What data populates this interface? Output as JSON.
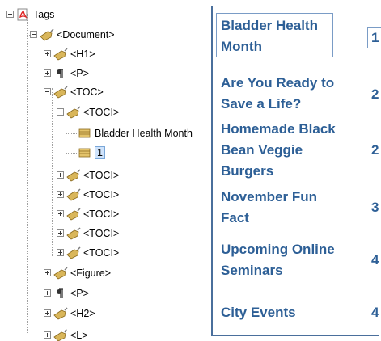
{
  "tree": {
    "root_label": "Tags",
    "nodes": [
      {
        "label": "<Document>",
        "state": "minus",
        "icon": "tag-icon"
      },
      {
        "label": "<H1>",
        "state": "plus",
        "icon": "tag-icon"
      },
      {
        "label": "<P>",
        "state": "plus",
        "icon": "paragraph-icon"
      },
      {
        "label": "<TOC>",
        "state": "minus",
        "icon": "tag-icon"
      },
      {
        "label": "<TOCI>",
        "state": "minus",
        "icon": "tag-icon"
      },
      {
        "label": "Bladder Health Month",
        "state": "leaf",
        "icon": "content-icon"
      },
      {
        "label": "1",
        "state": "leaf",
        "icon": "content-icon",
        "selected": true
      },
      {
        "label": "<TOCI>",
        "state": "plus",
        "icon": "tag-icon"
      },
      {
        "label": "<TOCI>",
        "state": "plus",
        "icon": "tag-icon"
      },
      {
        "label": "<TOCI>",
        "state": "plus",
        "icon": "tag-icon"
      },
      {
        "label": "<TOCI>",
        "state": "plus",
        "icon": "tag-icon"
      },
      {
        "label": "<TOCI>",
        "state": "plus",
        "icon": "tag-icon"
      },
      {
        "label": "<Figure>",
        "state": "plus",
        "icon": "tag-icon"
      },
      {
        "label": "<P>",
        "state": "plus",
        "icon": "paragraph-icon"
      },
      {
        "label": "<H2>",
        "state": "plus",
        "icon": "tag-icon"
      },
      {
        "label": "<L>",
        "state": "plus",
        "icon": "tag-icon"
      }
    ]
  },
  "toc": {
    "entries": [
      {
        "title": "Bladder Health Month",
        "page": "1"
      },
      {
        "title": "Are You Ready to Save a Life?",
        "page": "2"
      },
      {
        "title": "Homemade Black Bean Veggie Burgers",
        "page": "2"
      },
      {
        "title": "November Fun Fact",
        "page": "3"
      },
      {
        "title": "Upcoming Online Seminars",
        "page": "4"
      },
      {
        "title": "City Events",
        "page": "4"
      }
    ]
  },
  "colors": {
    "toc_text": "#2d5f96",
    "toc_border": "#4a6f9c",
    "selection": "#cfe3fb",
    "tag_icon": "#c9a441"
  }
}
